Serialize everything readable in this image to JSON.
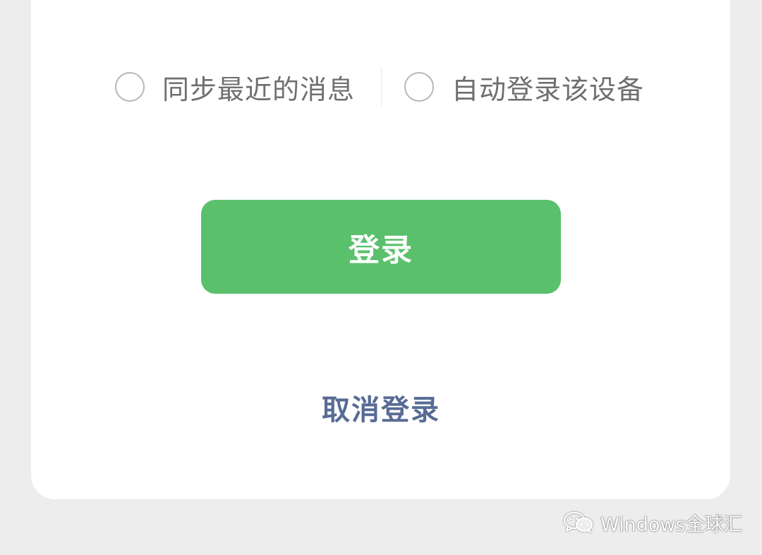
{
  "options": {
    "sync_label": "同步最近的消息",
    "auto_login_label": "自动登录该设备"
  },
  "buttons": {
    "login_label": "登录",
    "cancel_label": "取消登录"
  },
  "watermark": {
    "text": "Windows全球汇"
  },
  "colors": {
    "accent_green": "#5ac06c",
    "link_blue": "#576b95",
    "background": "#ededed"
  }
}
